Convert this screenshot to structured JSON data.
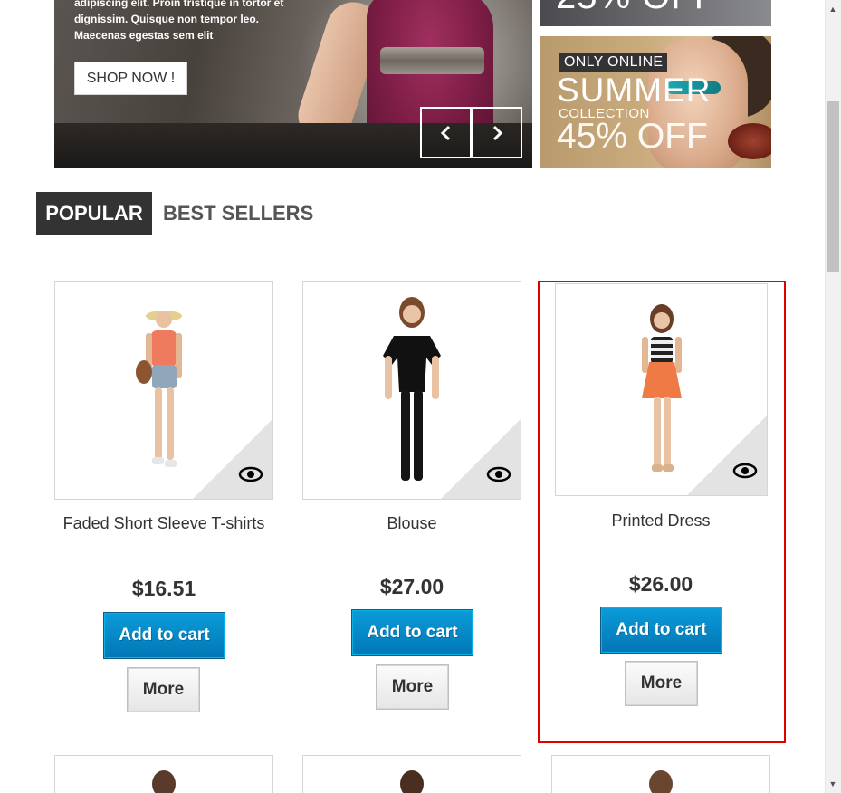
{
  "hero": {
    "text_lines": [
      "adipiscing elit. Proin tristique in tortor et",
      "dignissim. Quisque non tempor leo.",
      "Maecenas egestas sem elit"
    ],
    "shop_now_label": "SHOP NOW !",
    "prev_icon": "chevron-left-icon",
    "next_icon": "chevron-right-icon"
  },
  "banners": {
    "top_partial_text": "25% OFF",
    "summer": {
      "badge": "ONLY ONLINE",
      "title": "SUMMER",
      "subtitle": "COLLECTION",
      "discount": "45% OFF"
    }
  },
  "tabs": {
    "popular": "POPULAR",
    "best_sellers": "BEST SELLERS"
  },
  "products": [
    {
      "name": "Faded Short Sleeve T-shirts",
      "price": "$16.51",
      "add_to_cart": "Add to cart",
      "more": "More",
      "quick_view_icon": "eye-icon"
    },
    {
      "name": "Blouse",
      "price": "$27.00",
      "add_to_cart": "Add to cart",
      "more": "More",
      "quick_view_icon": "eye-icon"
    },
    {
      "name": "Printed Dress",
      "price": "$26.00",
      "add_to_cart": "Add to cart",
      "more": "More",
      "quick_view_icon": "eye-icon"
    }
  ],
  "colors": {
    "tab_active_bg": "#333333",
    "add_to_cart_bg": "#0a8fcc",
    "highlight_border": "#e00000"
  }
}
